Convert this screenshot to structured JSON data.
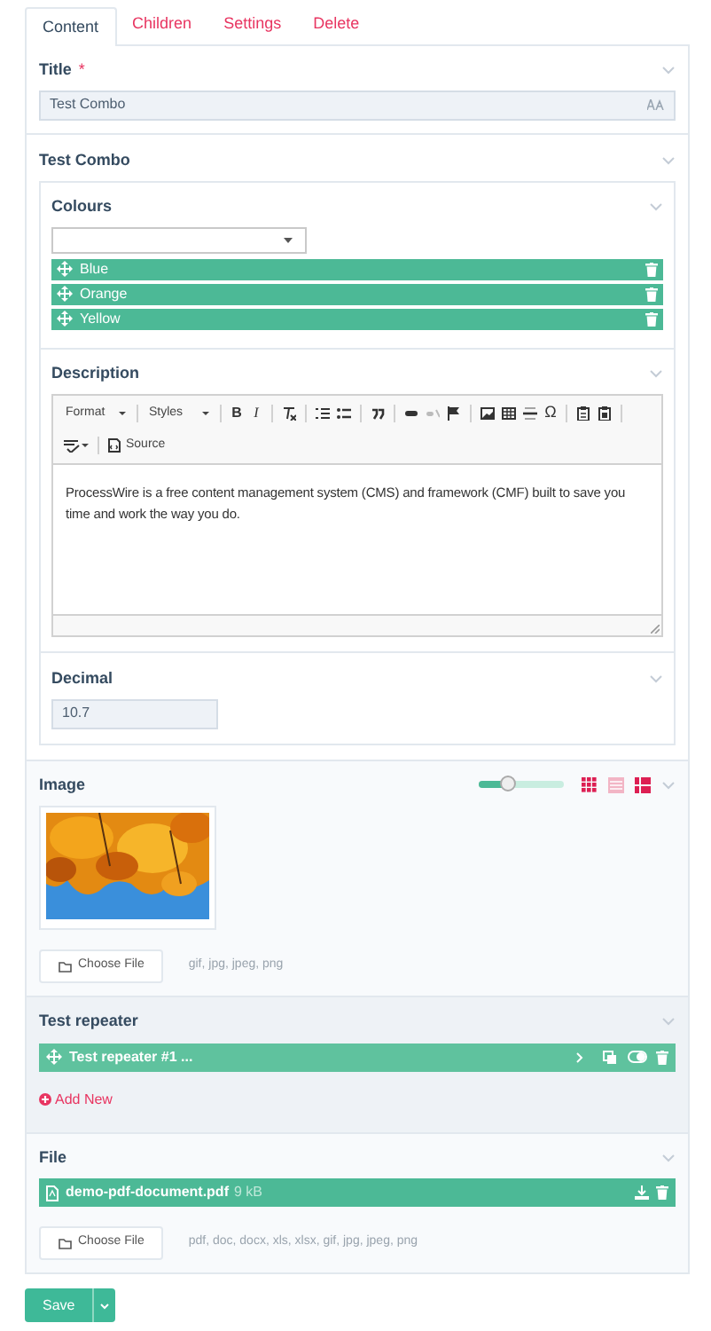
{
  "tabs": [
    {
      "label": "Content",
      "selected": true
    },
    {
      "label": "Children",
      "selected": false
    },
    {
      "label": "Settings",
      "selected": false
    },
    {
      "label": "Delete",
      "selected": false
    }
  ],
  "title_field": {
    "label": "Title",
    "required_mark": "*",
    "value": "Test Combo"
  },
  "combo": {
    "label": "Test Combo",
    "colours": {
      "label": "Colours",
      "items": [
        {
          "label": "Blue"
        },
        {
          "label": "Orange"
        },
        {
          "label": "Yellow"
        }
      ]
    },
    "description": {
      "label": "Description",
      "toolbar": {
        "format": "Format",
        "styles": "Styles",
        "bold": "B",
        "italic": "I",
        "special_char": "Ω",
        "source": "Source"
      },
      "text": "ProcessWire is a free content management system (CMS) and framework (CMF) built to save you time and work the way you do."
    },
    "decimal": {
      "label": "Decimal",
      "value": "10.7"
    }
  },
  "image": {
    "label": "Image",
    "size_slider": {
      "level": 0.33
    },
    "choose_button": "Choose File",
    "extensions": "gif, jpg, jpeg, png"
  },
  "repeater": {
    "label": "Test repeater",
    "items": [
      {
        "title": "Test repeater #1 ..."
      }
    ],
    "add_new": "Add New"
  },
  "file": {
    "label": "File",
    "files": [
      {
        "name": "demo-pdf-document.pdf",
        "size": "9 kB"
      }
    ],
    "choose_button": "Choose File",
    "extensions": "pdf, doc, docx, xls, xlsx, gif, jpg, jpeg, png"
  },
  "save_button": "Save"
}
